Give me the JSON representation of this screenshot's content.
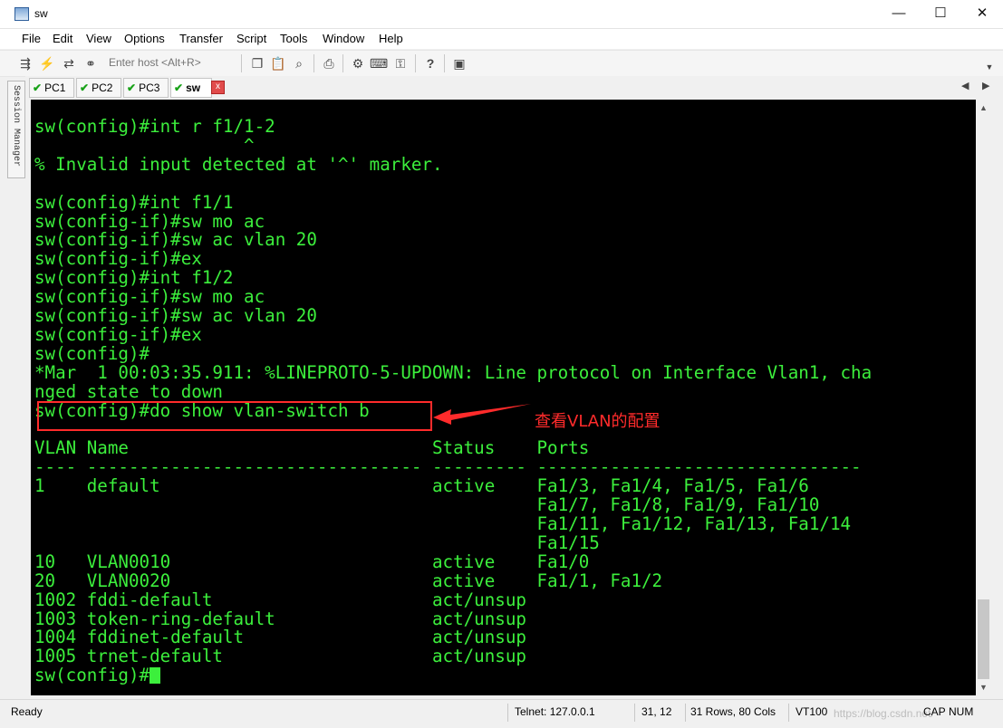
{
  "window": {
    "title": "sw",
    "minimize_glyph": "—",
    "maximize_glyph": "☐",
    "close_glyph": "✕"
  },
  "menu": [
    "File",
    "Edit",
    "View",
    "Options",
    "Transfer",
    "Script",
    "Tools",
    "Window",
    "Help"
  ],
  "toolbar": {
    "host_placeholder": "Enter host <Alt+R>",
    "icons": [
      "connect-icon",
      "lightning-icon",
      "reconnect-icon",
      "disconnect-icon",
      "copy-icon",
      "paste-icon",
      "find-icon",
      "print-icon",
      "settings-icon",
      "keymap-icon",
      "key-icon",
      "help-icon",
      "session-icon"
    ]
  },
  "tabs": [
    {
      "label": "PC1",
      "active": false
    },
    {
      "label": "PC2",
      "active": false
    },
    {
      "label": "PC3",
      "active": false
    },
    {
      "label": "sw",
      "active": true
    }
  ],
  "tab_close_glyph": "x",
  "session_manager_label": "Session Manager",
  "terminal": {
    "lines": [
      "sw(config)#int r f1/1-2",
      "                    ^",
      "% Invalid input detected at '^' marker.",
      "",
      "sw(config)#int f1/1",
      "sw(config-if)#sw mo ac",
      "sw(config-if)#sw ac vlan 20",
      "sw(config-if)#ex",
      "sw(config)#int f1/2",
      "sw(config-if)#sw mo ac",
      "sw(config-if)#sw ac vlan 20",
      "sw(config-if)#ex",
      "sw(config)#",
      "*Mar  1 00:03:35.911: %LINEPROTO-5-UPDOWN: Line protocol on Interface Vlan1, cha",
      "nged state to down",
      "sw(config)#do show vlan-switch b",
      "",
      "VLAN Name                             Status    Ports",
      "---- -------------------------------- --------- -------------------------------",
      "1    default                          active    Fa1/3, Fa1/4, Fa1/5, Fa1/6",
      "                                                Fa1/7, Fa1/8, Fa1/9, Fa1/10",
      "                                                Fa1/11, Fa1/12, Fa1/13, Fa1/14",
      "                                                Fa1/15",
      "10   VLAN0010                         active    Fa1/0",
      "20   VLAN0020                         active    Fa1/1, Fa1/2",
      "1002 fddi-default                     act/unsup",
      "1003 token-ring-default               act/unsup",
      "1004 fddinet-default                  act/unsup",
      "1005 trnet-default                    act/unsup"
    ],
    "prompt": "sw(config)#",
    "text_color": "#3cef3c",
    "background": "#000000"
  },
  "annotation": {
    "text": "查看VLAN的配置",
    "color": "#ff2b2b"
  },
  "statusbar": {
    "ready": "Ready",
    "connection": "Telnet: 127.0.0.1",
    "cursor_pos": "31,  12",
    "size": "31 Rows, 80 Cols",
    "emulation": "VT100",
    "caps": "CAP",
    "num": "NUM",
    "watermark": "https://blog.csdn.net/"
  }
}
